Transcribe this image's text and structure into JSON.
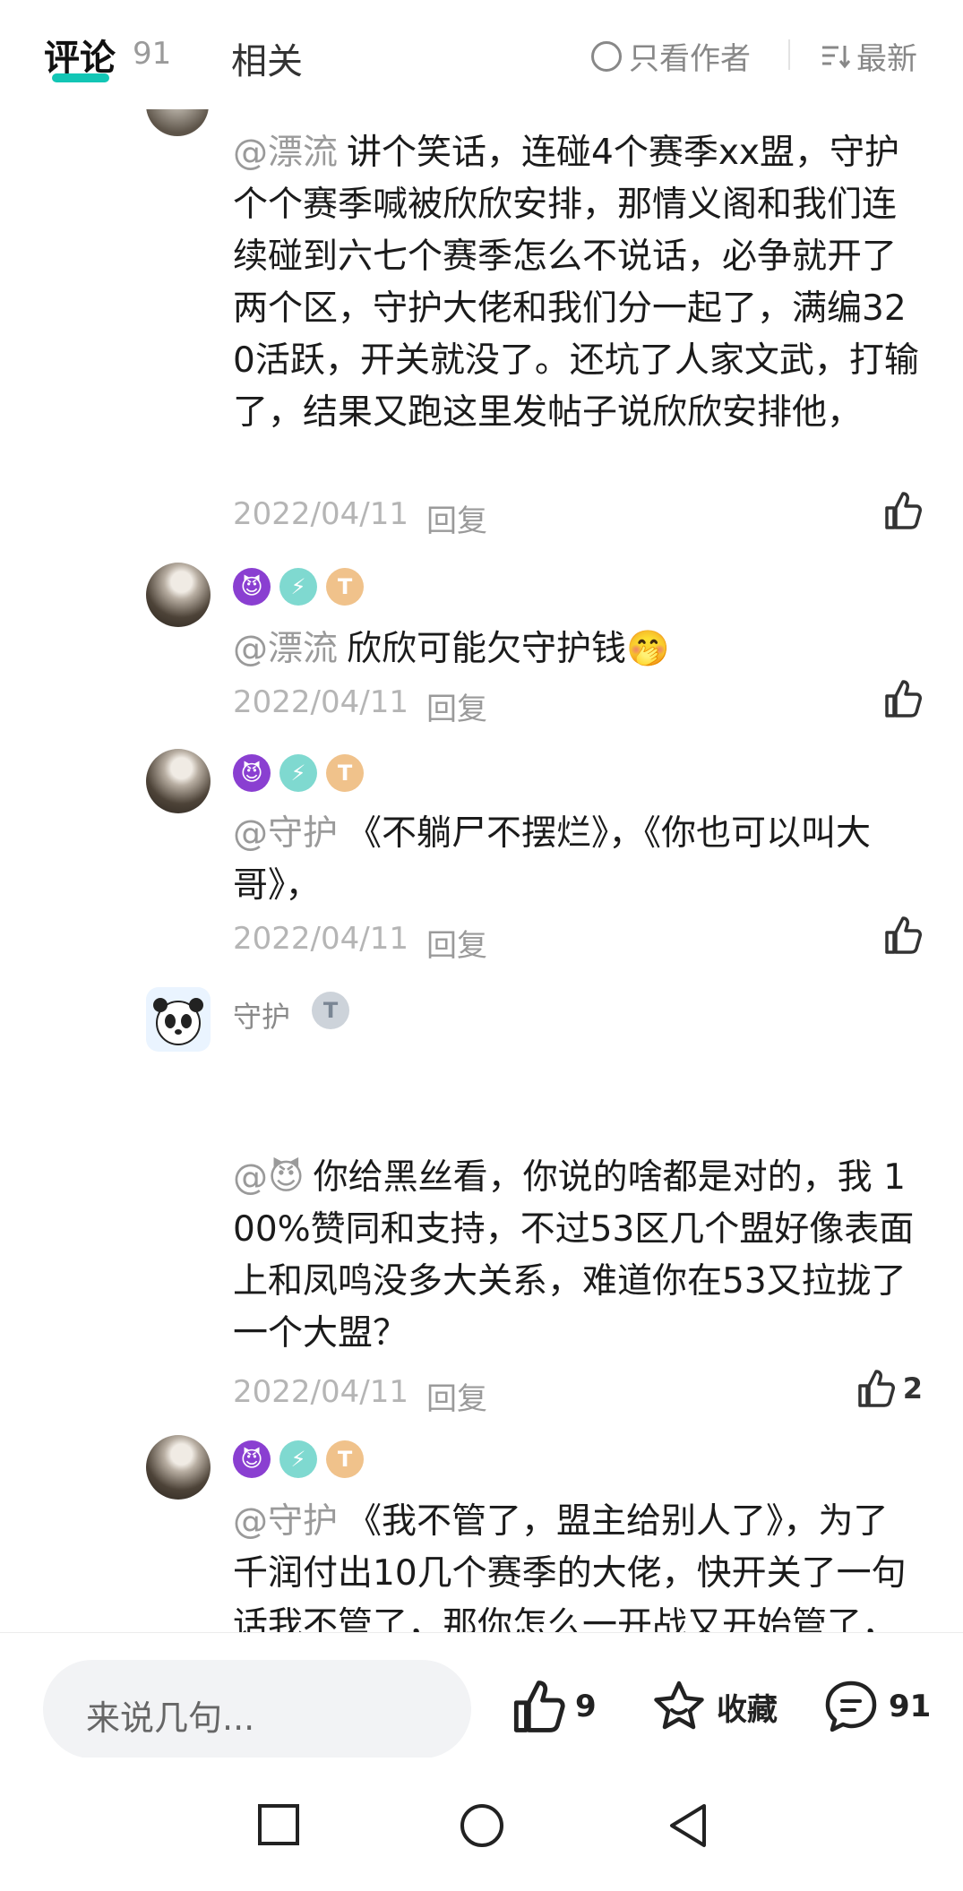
{
  "tabs": {
    "comments_label": "评论",
    "comments_count": "91",
    "related_label": "相关",
    "author_only_label": "只看作者",
    "sort_label": "最新"
  },
  "comments": [
    {
      "username": "",
      "badges": [],
      "mention": "@漂流",
      "text": "讲个笑话，连碰4个赛季xx盟，守护个个赛季喊被欣欣安排，那情义阁和我们连续碰到六七个赛季怎么不说话，必争就开了两个区，守护大佬和我们分一起了，满编320活跃，开关就没了。还坑了人家文武，打输了，结果又跑这里发帖子说欣欣安排他，",
      "date": "2022/04/11",
      "reply_label": "回复",
      "likes": ""
    },
    {
      "username": "",
      "badges": [
        "devil-badge",
        "level-badge",
        "t5-badge"
      ],
      "mention": "@漂流",
      "text": "欣欣可能欠守护钱🤭",
      "date": "2022/04/11",
      "reply_label": "回复",
      "likes": ""
    },
    {
      "username": "",
      "badges": [
        "devil-badge",
        "level-badge",
        "t5-badge"
      ],
      "mention": "@守护",
      "text": "《不躺尸不摆烂》，《你也可以叫大哥》，",
      "date": "2022/04/11",
      "reply_label": "回复",
      "likes": ""
    },
    {
      "username": "守护",
      "badges": [
        "t3-badge"
      ],
      "mention": "@😈",
      "text": "你给黑丝看，你说的啥都是对的，我 100%赞同和支持，不过53区几个盟好像表面上和凤鸣没多大关系，难道你在53又拉拢了一个大盟？",
      "date": "2022/04/11",
      "reply_label": "回复",
      "likes": "2"
    },
    {
      "username": "",
      "badges": [
        "devil-badge",
        "level-badge",
        "t5-badge"
      ],
      "mention": "@守护",
      "text": "《我不管了，盟主给别人了》，为了千润付出10几个赛季的大佬，快开关了一句话我不管了，那你怎么一开战又开始管了，你快开关解盟不是存心找骂，换谁不骂你，",
      "date": "",
      "reply_label": "",
      "likes": ""
    }
  ],
  "bottom": {
    "input_placeholder": "来说几句...",
    "like_count": "9",
    "favorite_label": "收藏",
    "comment_count": "91"
  },
  "colors": {
    "accent": "#12c6b5",
    "muted": "#9a9a9a"
  }
}
